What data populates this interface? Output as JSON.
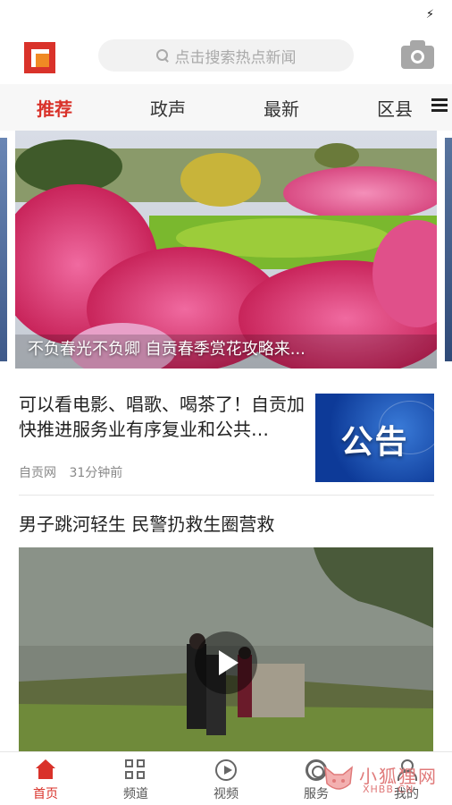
{
  "status_bar": {
    "charging_glyph": "⚡"
  },
  "header": {
    "search_placeholder": "点击搜索热点新闻",
    "logo_icon": "app-logo-icon",
    "camera_icon": "camera-icon",
    "brand_colors": {
      "red": "#d9322a",
      "orange": "#f08a24"
    }
  },
  "tabs": [
    {
      "label": "推荐",
      "active": true
    },
    {
      "label": "政声",
      "active": false
    },
    {
      "label": "最新",
      "active": false
    },
    {
      "label": "区县",
      "active": false
    }
  ],
  "carousel": {
    "caption": "不负春光不负卿 自贡春季赏花攻略来..."
  },
  "news": [
    {
      "title": "可以看电影、唱歌、喝茶了！自贡加快推进服务业有序复业和公共…",
      "source": "自贡网",
      "time": "31分钟前",
      "thumbnail_label": "公告"
    },
    {
      "title": "男子跳河轻生 民警扔救生圈营救",
      "has_video": true
    }
  ],
  "bottom_nav": [
    {
      "label": "首页",
      "icon": "home-icon",
      "active": true
    },
    {
      "label": "频道",
      "icon": "grid-icon",
      "active": false
    },
    {
      "label": "视频",
      "icon": "play-circle-icon",
      "active": false
    },
    {
      "label": "服务",
      "icon": "service-icon",
      "active": false
    },
    {
      "label": "我的",
      "icon": "user-icon",
      "active": false
    }
  ],
  "watermark": {
    "text": "小狐狸网",
    "domain": "XHBB.CN"
  },
  "accent_color": "#d9322a"
}
